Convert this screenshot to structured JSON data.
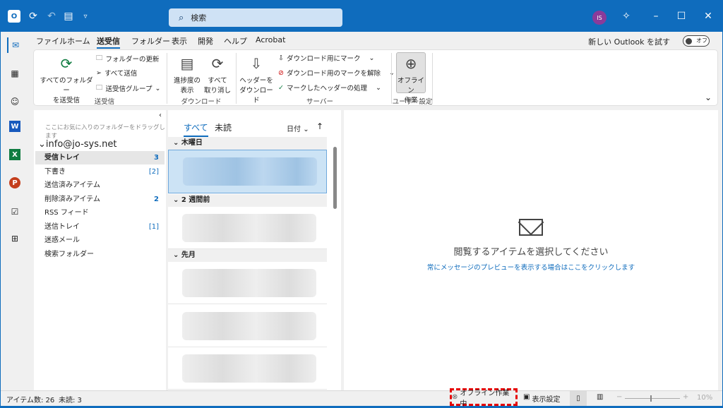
{
  "titlebar": {
    "search_placeholder": "検索",
    "avatar_initials": "IS"
  },
  "menu": {
    "items": [
      "ファイル",
      "ホーム",
      "送受信",
      "フォルダー",
      "表示",
      "開発",
      "ヘルプ",
      "Acrobat"
    ],
    "active": "送受信",
    "new_outlook_label": "新しい Outlook を試す",
    "toggle_label": "オフ"
  },
  "ribbon": {
    "sendrecv_all_line1": "すべてのフォルダー",
    "sendrecv_all_line2": "を送受信",
    "update_folder": "フォルダーの更新",
    "send_all": "すべて送信",
    "sendrecv_groups": "送受信グループ",
    "group_sendrecv": "送受信",
    "progress_line1": "進捗度の",
    "progress_line2": "表示",
    "cancel_all_line1": "すべて",
    "cancel_all_line2": "取り消し",
    "group_download": "ダウンロード",
    "headers_line1": "ヘッダーを",
    "headers_line2": "ダウンロード",
    "mark_download": "ダウンロード用にマーク",
    "unmark_download": "ダウンロード用のマークを解除",
    "process_marked": "マークしたヘッダーの処理",
    "group_server": "サーバー",
    "offline_line1": "オフライン",
    "offline_line2": "作業",
    "group_prefs": "ユーザー設定"
  },
  "folders": {
    "favorites_hint": "ここにお気に入りのフォルダーをドラッグします",
    "account": "info@jo-sys.net",
    "items": [
      {
        "label": "受信トレイ",
        "count": "3"
      },
      {
        "label": "下書き",
        "count": "[2]"
      },
      {
        "label": "送信済みアイテム",
        "count": ""
      },
      {
        "label": "削除済みアイテム",
        "count": "2"
      },
      {
        "label": "RSS フィード",
        "count": ""
      },
      {
        "label": "送信トレイ",
        "count": "[1]"
      },
      {
        "label": "迷惑メール",
        "count": ""
      },
      {
        "label": "検索フォルダー",
        "count": ""
      }
    ]
  },
  "msglist": {
    "tab_all": "すべて",
    "tab_unread": "未読",
    "sort_label": "日付",
    "groups": [
      "木曜日",
      "2 週間前",
      "先月"
    ]
  },
  "reading": {
    "message": "閲覧するアイテムを選択してください",
    "link": "常にメッセージのプレビューを表示する場合はここをクリックします"
  },
  "status": {
    "items_label": "アイテム数: 26",
    "unread_label": "未読: 3",
    "offline_label": "オフライン作業中",
    "view_settings": "表示設定",
    "zoom": "10%"
  },
  "colors": {
    "accent": "#0f6cbd",
    "highlight": "#e60000"
  }
}
